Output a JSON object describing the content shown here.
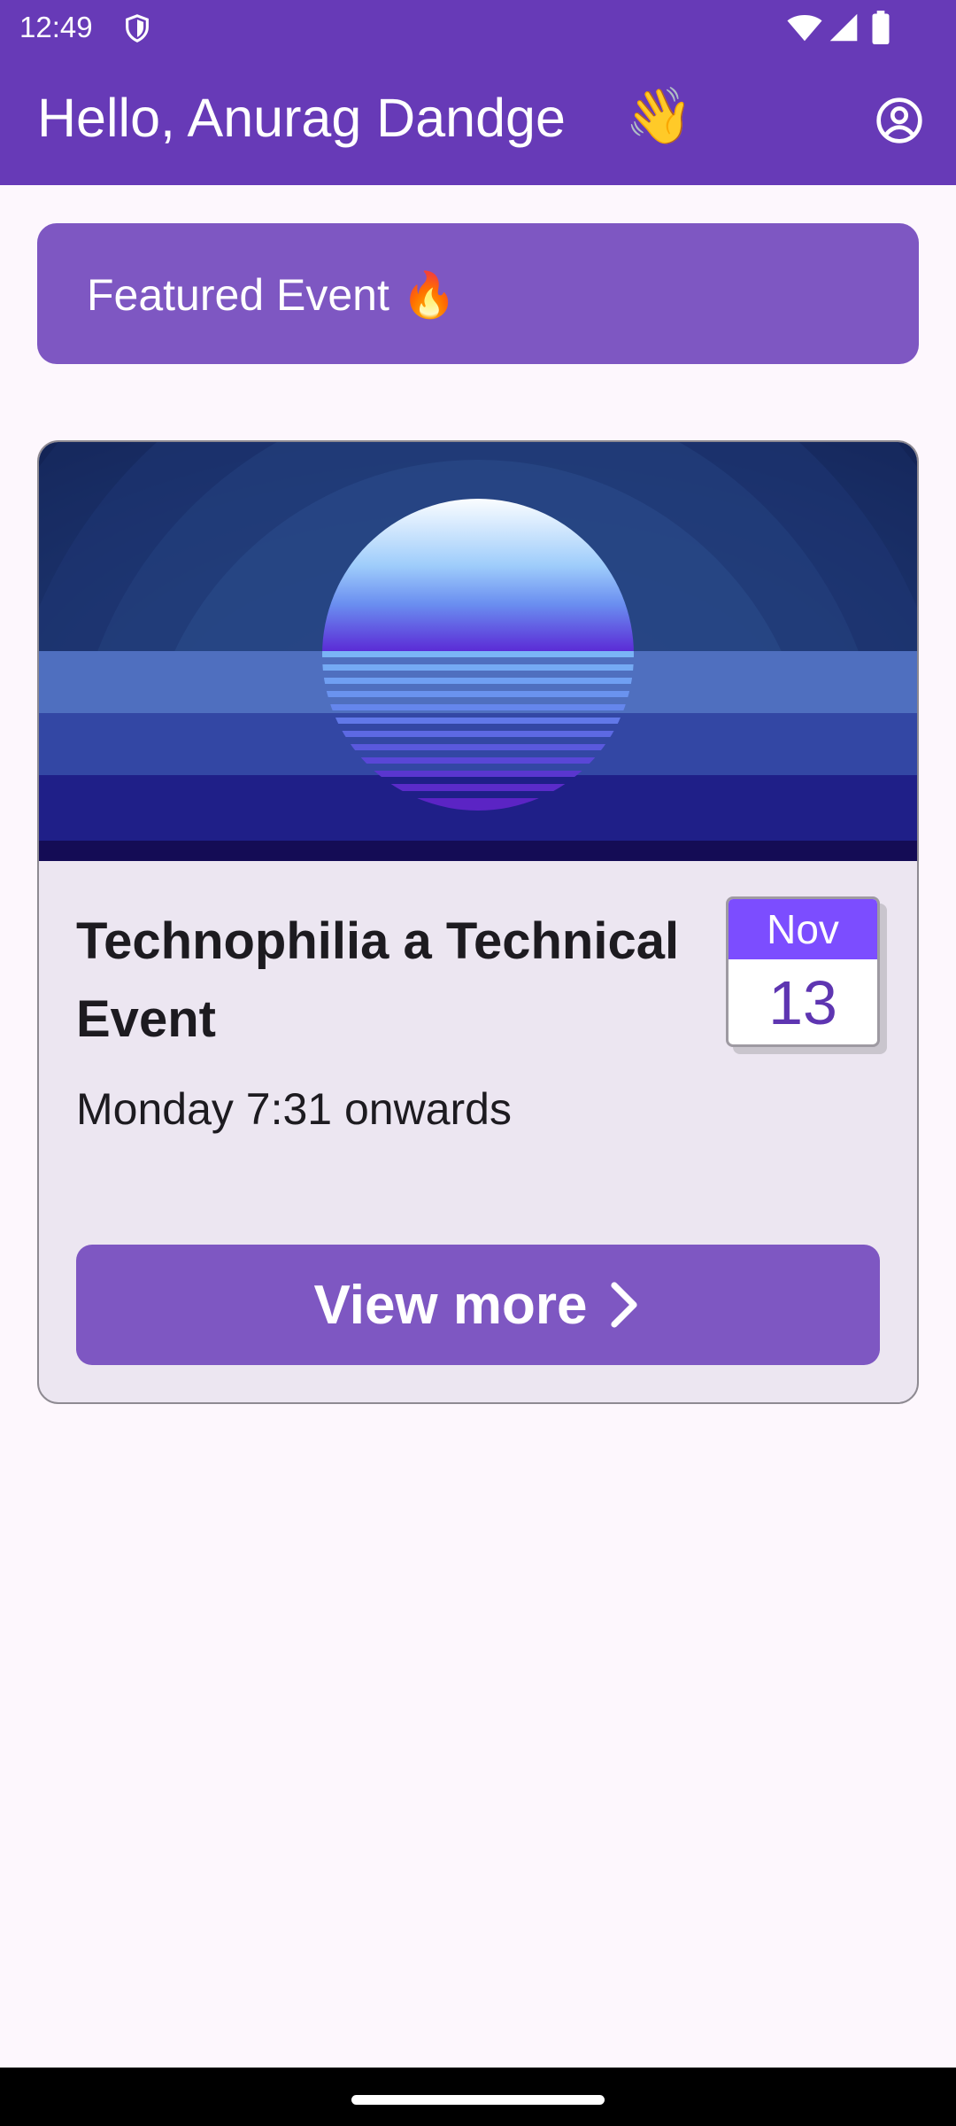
{
  "status_bar": {
    "time": "12:49",
    "icons": [
      "shield-icon",
      "wifi-icon",
      "signal-icon",
      "battery-icon"
    ]
  },
  "app_bar": {
    "greeting": "Hello, Anurag Dandge",
    "wave_emoji": "👋",
    "profile_icon": "account-circle-icon"
  },
  "featured": {
    "label": "Featured Event",
    "emoji": "🔥"
  },
  "event": {
    "title": "Technophilia a Technical Event",
    "time": "Monday 7:31 onwards",
    "date_month": "Nov",
    "date_day": "13",
    "button_label": "View more",
    "button_icon": "chevron-right-icon"
  },
  "colors": {
    "primary": "#673ab7",
    "banner": "#7e57c2",
    "card_background": "#ece6f1",
    "calendar_header": "#7c4dff",
    "calendar_day_text": "#5e35b1",
    "page_background": "#fdf7fd"
  }
}
